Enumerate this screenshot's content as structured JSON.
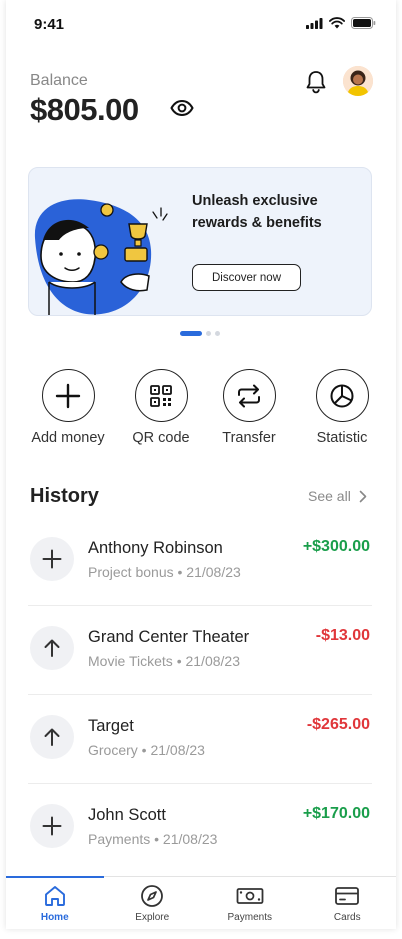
{
  "status_bar": {
    "time": "9:41"
  },
  "header": {
    "balance_label": "Balance",
    "balance_value": "$805.00",
    "icons": [
      "eye-icon",
      "bell-icon",
      "avatar"
    ]
  },
  "banner": {
    "title": "Unleash exclusive rewards & benefits",
    "button_label": "Discover now",
    "page_indicator": {
      "active": 1,
      "total": 3
    }
  },
  "actions": [
    {
      "label": "Add money",
      "icon": "plus-icon"
    },
    {
      "label": "QR code",
      "icon": "qr-code-icon"
    },
    {
      "label": "Transfer",
      "icon": "transfer-icon"
    },
    {
      "label": "Statistic",
      "icon": "pie-chart-icon"
    }
  ],
  "history": {
    "title": "History",
    "see_all": "See all",
    "transactions": [
      {
        "name": "Anthony Robinson",
        "subtitle": "Project bonus • 21/08/23",
        "amount": "+$300.00",
        "direction": "in"
      },
      {
        "name": "Grand Center Theater",
        "subtitle": "Movie Tickets • 21/08/23",
        "amount": "-$13.00",
        "direction": "out"
      },
      {
        "name": "Target",
        "subtitle": "Grocery • 21/08/23",
        "amount": "-$265.00",
        "direction": "out"
      },
      {
        "name": "John Scott",
        "subtitle": "Payments • 21/08/23",
        "amount": "+$170.00",
        "direction": "in"
      }
    ]
  },
  "bottom_nav": [
    {
      "label": "Home",
      "icon": "home-icon",
      "active": true
    },
    {
      "label": "Explore",
      "icon": "compass-icon",
      "active": false
    },
    {
      "label": "Payments",
      "icon": "banknote-icon",
      "active": false
    },
    {
      "label": "Cards",
      "icon": "card-icon",
      "active": false
    }
  ],
  "colors": {
    "accent": "#2a6bdc",
    "positive": "#1a9e4b",
    "negative": "#e0363a"
  }
}
